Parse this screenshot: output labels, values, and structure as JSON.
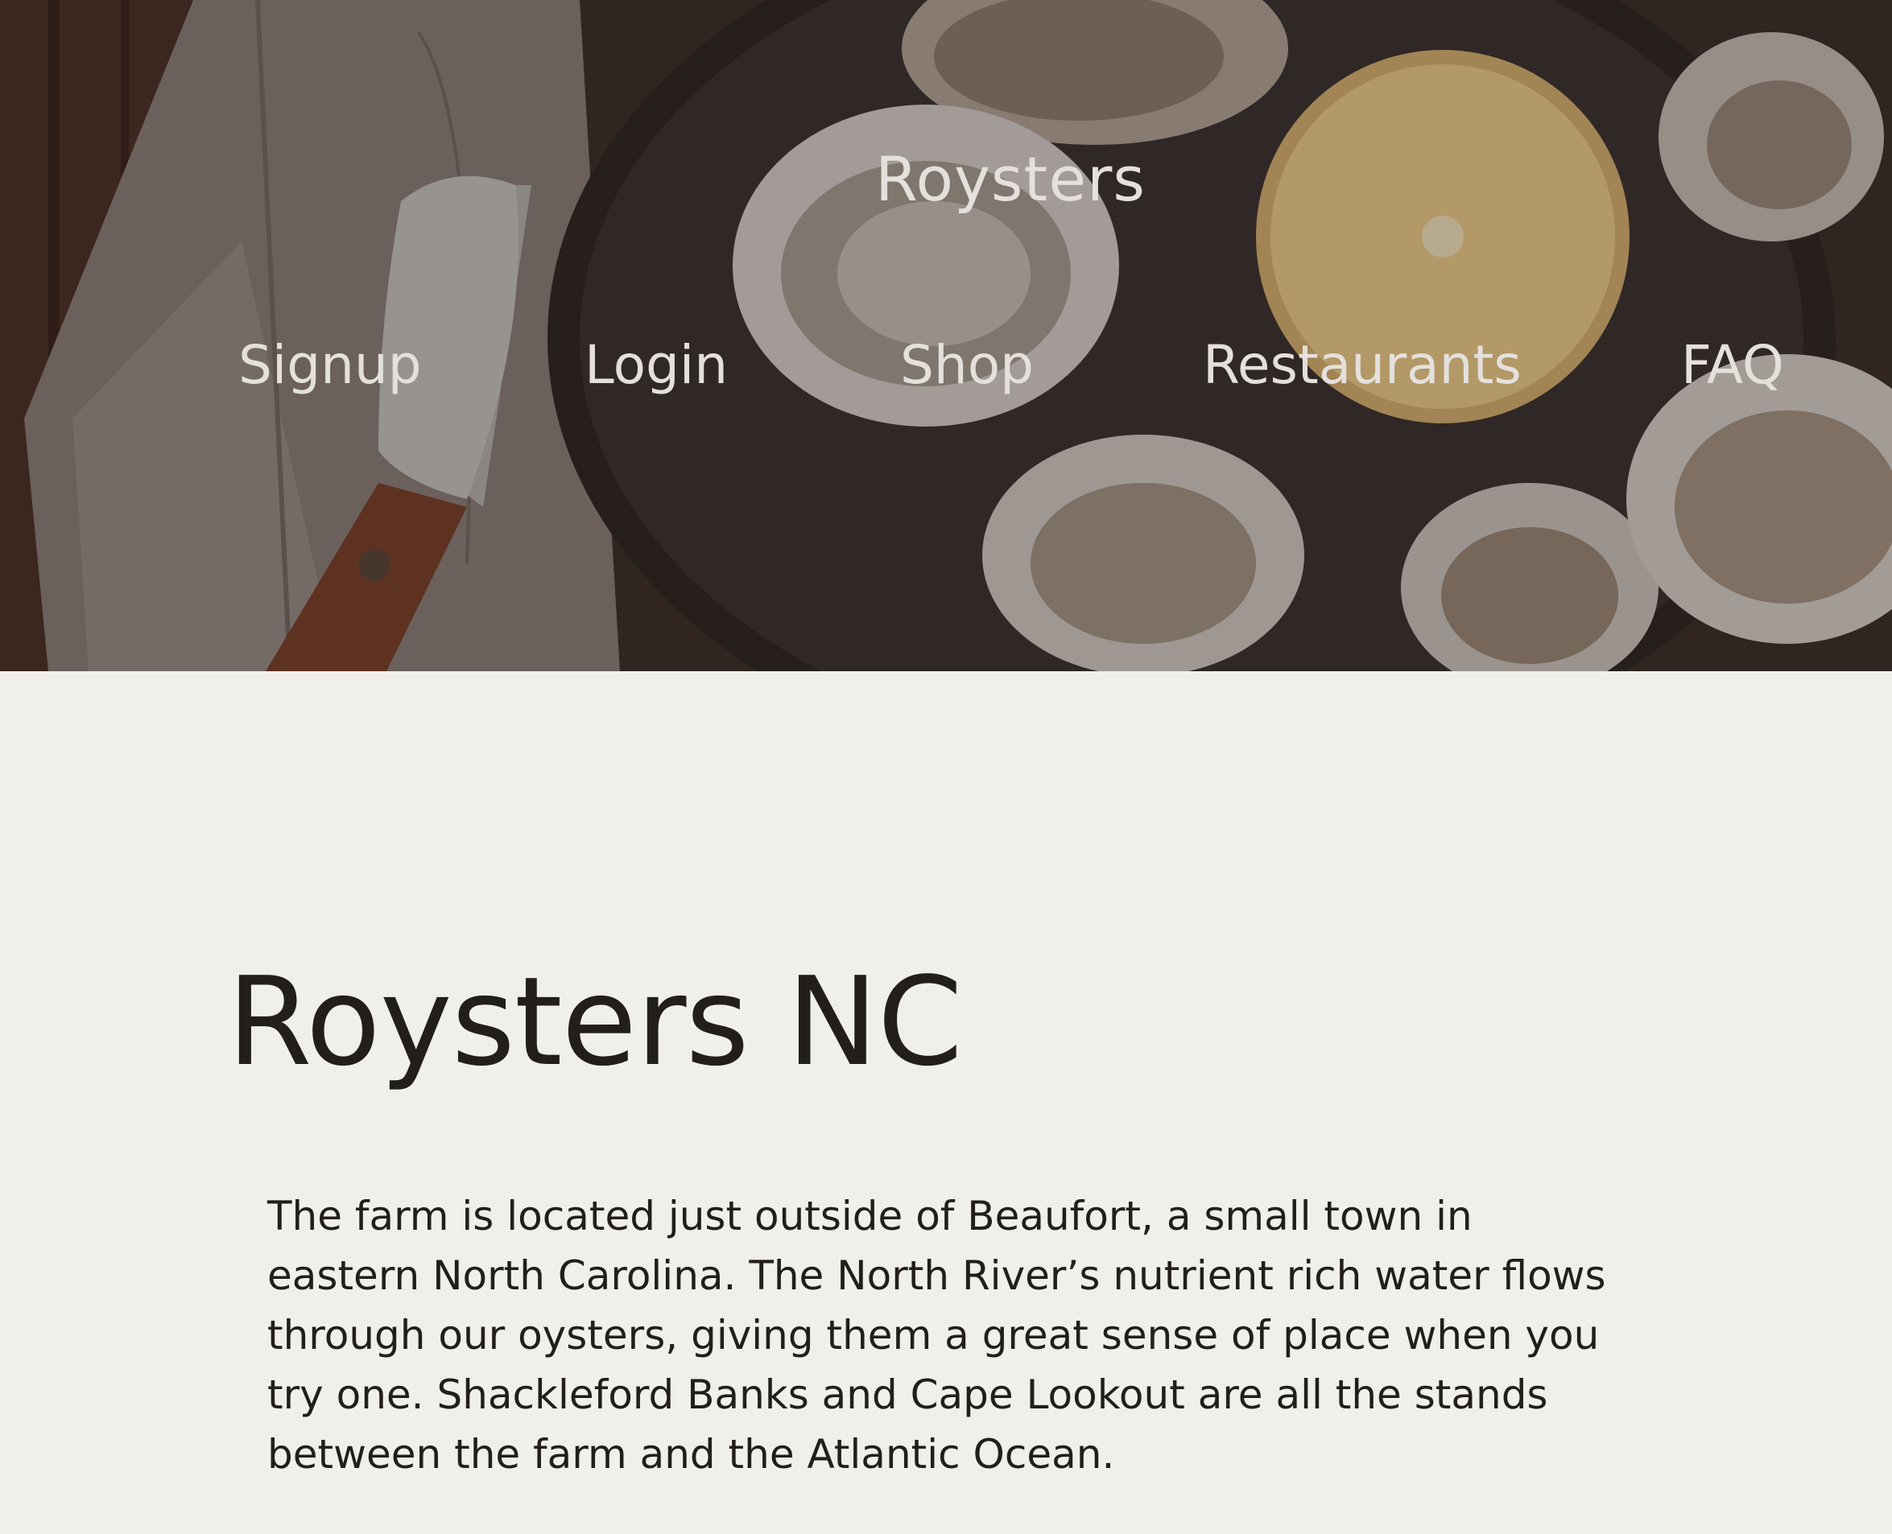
{
  "header": {
    "site_title": "Roysters",
    "nav": {
      "signup": "Signup",
      "login": "Login",
      "shop": "Shop",
      "restaurants": "Restaurants",
      "faq": "FAQ"
    }
  },
  "main": {
    "heading": "Roysters NC",
    "paragraph": "The farm is located just outside of Beaufort, a small town in eastern North Carolina. The North River’s nutrient rich water flows through our oysters, giving them a great sense of place when you try one. Shackleford Banks and Cape Lookout are all the stands between the farm and the Atlantic Ocean."
  },
  "colors": {
    "page_background": "#f0efeb",
    "text": "#221e1b",
    "nav_text": "#e4e0dc"
  }
}
